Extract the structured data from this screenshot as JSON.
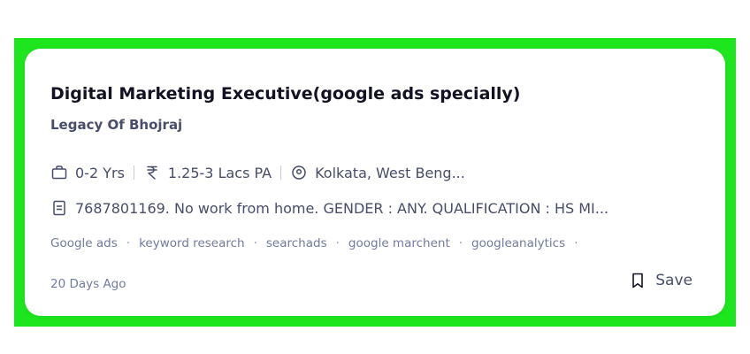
{
  "job": {
    "title": "Digital Marketing Executive(google ads specially)",
    "company": "Legacy Of Bhojraj",
    "experience": "0-2 Yrs",
    "salary": "1.25-3 Lacs PA",
    "location": "Kolkata, West Beng...",
    "description": "7687801169. No work from home. GENDER : ANY. QUALIFICATION : HS MI...",
    "tags": [
      "Google ads",
      "keyword research",
      "searchads",
      "google marchent",
      "googleanalytics"
    ],
    "posted": "20 Days Ago",
    "save_label": "Save"
  },
  "icons": {
    "experience": "briefcase-icon",
    "salary": "rupee-icon",
    "location": "location-pin-icon",
    "description": "document-icon",
    "save": "bookmark-icon"
  },
  "colors": {
    "highlight_border": "#1ee61e",
    "title": "#121224",
    "text": "#474d6a",
    "muted": "#717b9e"
  }
}
